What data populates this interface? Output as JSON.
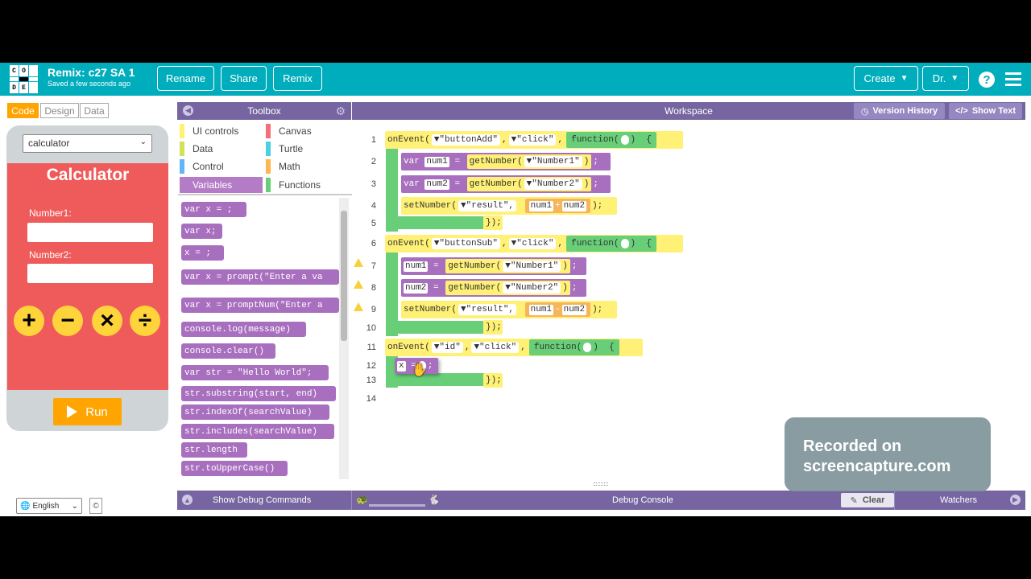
{
  "header": {
    "logo_letters": [
      "C",
      "O",
      "D",
      "",
      "",
      ".",
      "D",
      "E",
      ""
    ],
    "project_title": "Remix: c27 SA 1",
    "saved_status": "Saved a few seconds ago",
    "buttons": {
      "rename": "Rename",
      "share": "Share",
      "remix": "Remix",
      "create": "Create",
      "user": "Dr."
    }
  },
  "left": {
    "tabs": {
      "code": "Code",
      "design": "Design",
      "data": "Data"
    },
    "screen_select": "calculator",
    "app": {
      "title": "Calculator",
      "number1_label": "Number1:",
      "number2_label": "Number2:",
      "ops": [
        "+",
        "−",
        "×",
        "÷"
      ]
    },
    "run_label": "Run",
    "language": "English",
    "copyright": "©"
  },
  "toolbox": {
    "title": "Toolbox",
    "categories": [
      "UI controls",
      "Canvas",
      "Data",
      "Turtle",
      "Control",
      "Math",
      "Variables",
      "Functions"
    ],
    "blocks": [
      "var x = ;",
      "var x;",
      "x = ;",
      "var x = prompt(\"Enter a va",
      "var x = promptNum(\"Enter a",
      "console.log(message)",
      "console.clear()",
      "var str = \"Hello World\";",
      "str.substring(start, end)",
      "str.indexOf(searchValue)",
      "str.includes(searchValue)",
      "str.length",
      "str.toUpperCase()"
    ]
  },
  "workspace": {
    "title": "Workspace",
    "version_history": "Version History",
    "show_text": "Show Text",
    "line_numbers": [
      "1",
      "2",
      "3",
      "4",
      "5",
      "6",
      "7",
      "8",
      "9",
      "10",
      "11",
      "12",
      "13",
      "14"
    ],
    "code": {
      "ev1": {
        "fn": "onEvent(",
        "id": "\"buttonAdd\"",
        "evt": "\"click\"",
        "function": "function",
        "brace": "{"
      },
      "l2": {
        "kw": "var",
        "name": "num1",
        "eq": "=",
        "call": "getNumber(",
        "arg": "\"Number1\"",
        "end": ");"
      },
      "l3": {
        "kw": "var",
        "name": "num2",
        "eq": "=",
        "call": "getNumber(",
        "arg": "\"Number2\"",
        "end": ");"
      },
      "l4": {
        "call": "setNumber(",
        "arg": "\"result\",",
        "a": "num1",
        "op": "+",
        "b": "num2",
        "end": ");"
      },
      "close": "});",
      "ev2": {
        "fn": "onEvent(",
        "id": "\"buttonSub\"",
        "evt": "\"click\"",
        "function": "function",
        "brace": "{"
      },
      "l7": {
        "name": "num1",
        "eq": "=",
        "call": "getNumber(",
        "arg": "\"Number1\"",
        "end": ");"
      },
      "l8": {
        "name": "num2",
        "eq": "=",
        "call": "getNumber(",
        "arg": "\"Number2\"",
        "end": ");"
      },
      "l9": {
        "call": "setNumber(",
        "arg": "\"result\",",
        "a": "num1",
        "op": "-",
        "b": "num2",
        "end": ");"
      },
      "ev3": {
        "fn": "onEvent(",
        "id": "\"id\"",
        "evt": "\"click\"",
        "function": "function",
        "brace": "{"
      },
      "l12": {
        "name": "x",
        "eq": "=",
        "end": ";"
      }
    }
  },
  "bottom": {
    "show_debug": "Show Debug Commands",
    "debug_console": "Debug Console",
    "clear": "Clear",
    "watchers": "Watchers"
  },
  "watermark": {
    "line1": "Recorded on",
    "line2": "screencapture.com"
  }
}
